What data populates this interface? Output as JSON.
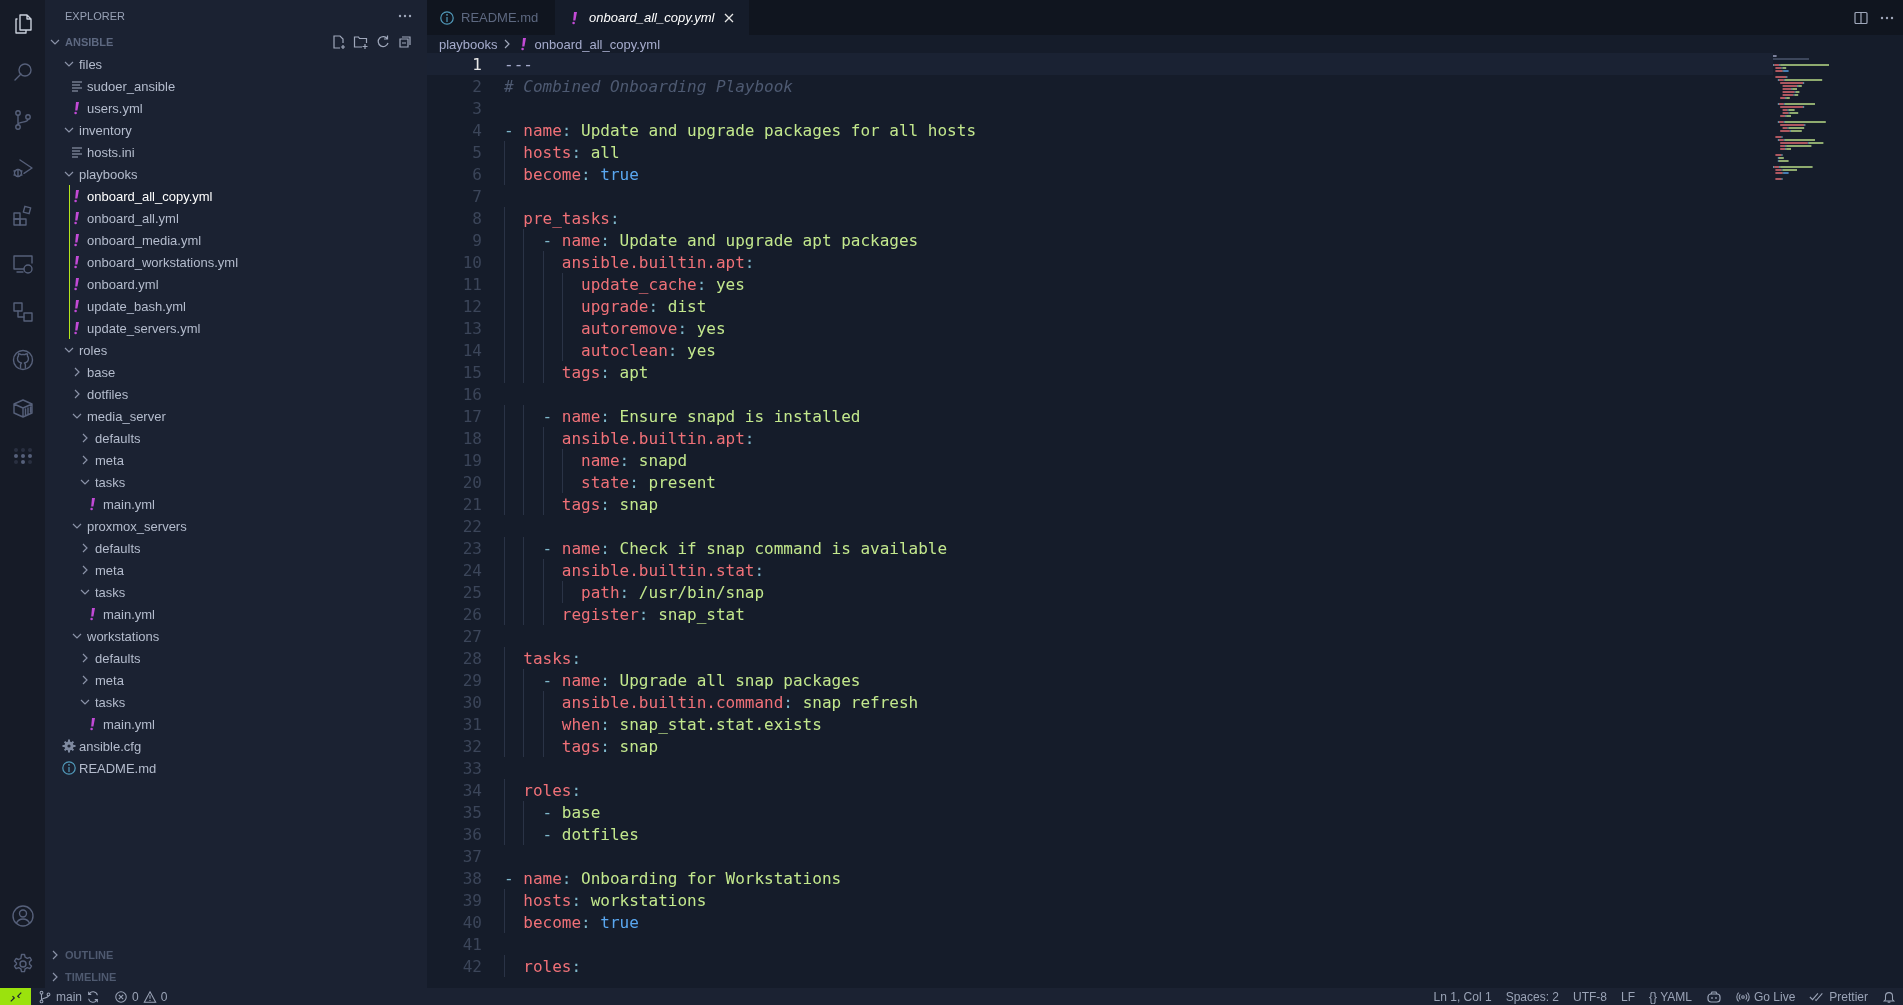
{
  "activity_bar": {
    "items": [
      {
        "kind": "explorer",
        "selected": true
      },
      {
        "kind": "search",
        "selected": false
      },
      {
        "kind": "source_control",
        "selected": false
      },
      {
        "kind": "run_debug",
        "selected": false
      },
      {
        "kind": "extensions",
        "selected": false
      },
      {
        "kind": "remote",
        "selected": false
      },
      {
        "kind": "nodes",
        "selected": false
      },
      {
        "kind": "github",
        "selected": false
      },
      {
        "kind": "container",
        "selected": false
      },
      {
        "kind": "dots",
        "selected": false
      }
    ],
    "bottom": [
      {
        "kind": "account"
      },
      {
        "kind": "settings"
      }
    ]
  },
  "sidebar": {
    "title": "EXPLORER",
    "section": {
      "label": "ANSIBLE",
      "expanded": true,
      "tree": [
        {
          "label": "files",
          "kind": "folder",
          "expanded": true,
          "selected": false,
          "children": [
            {
              "label": "sudoer_ansible",
              "kind": "text",
              "selected": false
            },
            {
              "label": "users.yml",
              "kind": "yaml",
              "selected": false
            }
          ]
        },
        {
          "label": "inventory",
          "kind": "folder",
          "expanded": true,
          "selected": false,
          "children": [
            {
              "label": "hosts.ini",
              "kind": "text",
              "selected": false
            }
          ]
        },
        {
          "label": "playbooks",
          "kind": "folder",
          "expanded": true,
          "selected": false,
          "children": [
            {
              "label": "onboard_all_copy.yml",
              "kind": "yaml",
              "selected": true
            },
            {
              "label": "onboard_all.yml",
              "kind": "yaml",
              "selected": false
            },
            {
              "label": "onboard_media.yml",
              "kind": "yaml",
              "selected": false
            },
            {
              "label": "onboard_workstations.yml",
              "kind": "yaml",
              "selected": false
            },
            {
              "label": "onboard.yml",
              "kind": "yaml",
              "selected": false
            },
            {
              "label": "update_bash.yml",
              "kind": "yaml",
              "selected": false
            },
            {
              "label": "update_servers.yml",
              "kind": "yaml",
              "selected": false
            }
          ]
        },
        {
          "label": "roles",
          "kind": "folder",
          "expanded": true,
          "selected": false,
          "children": [
            {
              "label": "base",
              "kind": "folder",
              "expanded": false,
              "selected": false
            },
            {
              "label": "dotfiles",
              "kind": "folder",
              "expanded": false,
              "selected": false
            },
            {
              "label": "media_server",
              "kind": "folder",
              "expanded": true,
              "selected": false,
              "children": [
                {
                  "label": "defaults",
                  "kind": "folder",
                  "expanded": false,
                  "selected": false
                },
                {
                  "label": "meta",
                  "kind": "folder",
                  "expanded": false,
                  "selected": false
                },
                {
                  "label": "tasks",
                  "kind": "folder",
                  "expanded": true,
                  "selected": false,
                  "children": [
                    {
                      "label": "main.yml",
                      "kind": "yaml",
                      "selected": false
                    }
                  ]
                }
              ]
            },
            {
              "label": "proxmox_servers",
              "kind": "folder",
              "expanded": true,
              "selected": false,
              "children": [
                {
                  "label": "defaults",
                  "kind": "folder",
                  "expanded": false,
                  "selected": false
                },
                {
                  "label": "meta",
                  "kind": "folder",
                  "expanded": false,
                  "selected": false
                },
                {
                  "label": "tasks",
                  "kind": "folder",
                  "expanded": true,
                  "selected": false,
                  "children": [
                    {
                      "label": "main.yml",
                      "kind": "yaml",
                      "selected": false
                    }
                  ]
                }
              ]
            },
            {
              "label": "workstations",
              "kind": "folder",
              "expanded": true,
              "selected": false,
              "children": [
                {
                  "label": "defaults",
                  "kind": "folder",
                  "expanded": false,
                  "selected": false
                },
                {
                  "label": "meta",
                  "kind": "folder",
                  "expanded": false,
                  "selected": false
                },
                {
                  "label": "tasks",
                  "kind": "folder",
                  "expanded": true,
                  "selected": false,
                  "children": [
                    {
                      "label": "main.yml",
                      "kind": "yaml",
                      "selected": false
                    }
                  ]
                }
              ]
            }
          ]
        },
        {
          "label": "ansible.cfg",
          "kind": "config",
          "selected": false
        },
        {
          "label": "README.md",
          "kind": "info",
          "selected": false
        }
      ]
    },
    "panels": [
      {
        "label": "OUTLINE",
        "expanded": false
      },
      {
        "label": "TIMELINE",
        "expanded": false
      }
    ]
  },
  "tabs": [
    {
      "label": "README.md",
      "kind": "info",
      "selected": false,
      "preview": false
    },
    {
      "label": "onboard_all_copy.yml",
      "kind": "yaml",
      "selected": true,
      "preview": true
    }
  ],
  "breadcrumb": [
    {
      "label": "playbooks",
      "kind": "folder"
    },
    {
      "label": "onboard_all_copy.yml",
      "kind": "yaml"
    }
  ],
  "editor": {
    "lines": [
      {
        "number": "1",
        "current": true,
        "tokens": [
          {
            "kind": "plain",
            "text": "---"
          }
        ]
      },
      {
        "number": "2",
        "current": false,
        "tokens": [
          {
            "kind": "comment",
            "text": "# Combined Onboarding Playbook"
          }
        ]
      },
      {
        "number": "3",
        "current": false
      },
      {
        "number": "4",
        "current": false,
        "tokens": [
          {
            "kind": "dash",
            "text": "- "
          },
          {
            "kind": "key",
            "text": "name"
          },
          {
            "kind": "punct",
            "text": ": "
          },
          {
            "kind": "string",
            "text": "Update and upgrade packages for all hosts"
          }
        ]
      },
      {
        "number": "5",
        "current": false,
        "tokens": [
          {
            "kind": "key",
            "text": "  hosts"
          },
          {
            "kind": "punct",
            "text": ": "
          },
          {
            "kind": "string",
            "text": "all"
          }
        ]
      },
      {
        "number": "6",
        "current": false,
        "tokens": [
          {
            "kind": "key",
            "text": "  become"
          },
          {
            "kind": "punct",
            "text": ": "
          },
          {
            "kind": "bool",
            "text": "true"
          }
        ]
      },
      {
        "number": "7",
        "current": false
      },
      {
        "number": "8",
        "current": false,
        "tokens": [
          {
            "kind": "key",
            "text": "  pre_tasks"
          },
          {
            "kind": "punct",
            "text": ":"
          }
        ]
      },
      {
        "number": "9",
        "current": false,
        "tokens": [
          {
            "kind": "dash",
            "text": "    - "
          },
          {
            "kind": "key",
            "text": "name"
          },
          {
            "kind": "punct",
            "text": ": "
          },
          {
            "kind": "string",
            "text": "Update and upgrade apt packages"
          }
        ]
      },
      {
        "number": "10",
        "current": false,
        "tokens": [
          {
            "kind": "key",
            "text": "      ansible.builtin.apt"
          },
          {
            "kind": "punct",
            "text": ":"
          }
        ]
      },
      {
        "number": "11",
        "current": false,
        "tokens": [
          {
            "kind": "key",
            "text": "        update_cache"
          },
          {
            "kind": "punct",
            "text": ": "
          },
          {
            "kind": "string",
            "text": "yes"
          }
        ]
      },
      {
        "number": "12",
        "current": false,
        "tokens": [
          {
            "kind": "key",
            "text": "        upgrade"
          },
          {
            "kind": "punct",
            "text": ": "
          },
          {
            "kind": "string",
            "text": "dist"
          }
        ]
      },
      {
        "number": "13",
        "current": false,
        "tokens": [
          {
            "kind": "key",
            "text": "        autoremove"
          },
          {
            "kind": "punct",
            "text": ": "
          },
          {
            "kind": "string",
            "text": "yes"
          }
        ]
      },
      {
        "number": "14",
        "current": false,
        "tokens": [
          {
            "kind": "key",
            "text": "        autoclean"
          },
          {
            "kind": "punct",
            "text": ": "
          },
          {
            "kind": "string",
            "text": "yes"
          }
        ]
      },
      {
        "number": "15",
        "current": false,
        "tokens": [
          {
            "kind": "key",
            "text": "      tags"
          },
          {
            "kind": "punct",
            "text": ": "
          },
          {
            "kind": "string",
            "text": "apt"
          }
        ]
      },
      {
        "number": "16",
        "current": false
      },
      {
        "number": "17",
        "current": false,
        "tokens": [
          {
            "kind": "dash",
            "text": "    - "
          },
          {
            "kind": "key",
            "text": "name"
          },
          {
            "kind": "punct",
            "text": ": "
          },
          {
            "kind": "string",
            "text": "Ensure snapd is installed"
          }
        ]
      },
      {
        "number": "18",
        "current": false,
        "tokens": [
          {
            "kind": "key",
            "text": "      ansible.builtin.apt"
          },
          {
            "kind": "punct",
            "text": ":"
          }
        ]
      },
      {
        "number": "19",
        "current": false,
        "tokens": [
          {
            "kind": "key",
            "text": "        name"
          },
          {
            "kind": "punct",
            "text": ": "
          },
          {
            "kind": "string",
            "text": "snapd"
          }
        ]
      },
      {
        "number": "20",
        "current": false,
        "tokens": [
          {
            "kind": "key",
            "text": "        state"
          },
          {
            "kind": "punct",
            "text": ": "
          },
          {
            "kind": "string",
            "text": "present"
          }
        ]
      },
      {
        "number": "21",
        "current": false,
        "tokens": [
          {
            "kind": "key",
            "text": "      tags"
          },
          {
            "kind": "punct",
            "text": ": "
          },
          {
            "kind": "string",
            "text": "snap"
          }
        ]
      },
      {
        "number": "22",
        "current": false
      },
      {
        "number": "23",
        "current": false,
        "tokens": [
          {
            "kind": "dash",
            "text": "    - "
          },
          {
            "kind": "key",
            "text": "name"
          },
          {
            "kind": "punct",
            "text": ": "
          },
          {
            "kind": "string",
            "text": "Check if snap command is available"
          }
        ]
      },
      {
        "number": "24",
        "current": false,
        "tokens": [
          {
            "kind": "key",
            "text": "      ansible.builtin.stat"
          },
          {
            "kind": "punct",
            "text": ":"
          }
        ]
      },
      {
        "number": "25",
        "current": false,
        "tokens": [
          {
            "kind": "key",
            "text": "        path"
          },
          {
            "kind": "punct",
            "text": ": "
          },
          {
            "kind": "string",
            "text": "/usr/bin/snap"
          }
        ]
      },
      {
        "number": "26",
        "current": false,
        "tokens": [
          {
            "kind": "key",
            "text": "      register"
          },
          {
            "kind": "punct",
            "text": ": "
          },
          {
            "kind": "string",
            "text": "snap_stat"
          }
        ]
      },
      {
        "number": "27",
        "current": false
      },
      {
        "number": "28",
        "current": false,
        "tokens": [
          {
            "kind": "key",
            "text": "  tasks"
          },
          {
            "kind": "punct",
            "text": ":"
          }
        ]
      },
      {
        "number": "29",
        "current": false,
        "tokens": [
          {
            "kind": "dash",
            "text": "    - "
          },
          {
            "kind": "key",
            "text": "name"
          },
          {
            "kind": "punct",
            "text": ": "
          },
          {
            "kind": "string",
            "text": "Upgrade all snap packages"
          }
        ]
      },
      {
        "number": "30",
        "current": false,
        "tokens": [
          {
            "kind": "key",
            "text": "      ansible.builtin.command"
          },
          {
            "kind": "punct",
            "text": ": "
          },
          {
            "kind": "string",
            "text": "snap refresh"
          }
        ]
      },
      {
        "number": "31",
        "current": false,
        "tokens": [
          {
            "kind": "key",
            "text": "      when"
          },
          {
            "kind": "punct",
            "text": ": "
          },
          {
            "kind": "string",
            "text": "snap_stat.stat.exists"
          }
        ]
      },
      {
        "number": "32",
        "current": false,
        "tokens": [
          {
            "kind": "key",
            "text": "      tags"
          },
          {
            "kind": "punct",
            "text": ": "
          },
          {
            "kind": "string",
            "text": "snap"
          }
        ]
      },
      {
        "number": "33",
        "current": false
      },
      {
        "number": "34",
        "current": false,
        "tokens": [
          {
            "kind": "key",
            "text": "  roles"
          },
          {
            "kind": "punct",
            "text": ":"
          }
        ]
      },
      {
        "number": "35",
        "current": false,
        "tokens": [
          {
            "kind": "dash",
            "text": "    - "
          },
          {
            "kind": "string",
            "text": "base"
          }
        ]
      },
      {
        "number": "36",
        "current": false,
        "tokens": [
          {
            "kind": "dash",
            "text": "    - "
          },
          {
            "kind": "string",
            "text": "dotfiles"
          }
        ]
      },
      {
        "number": "37",
        "current": false
      },
      {
        "number": "38",
        "current": false,
        "tokens": [
          {
            "kind": "dash",
            "text": "- "
          },
          {
            "kind": "key",
            "text": "name"
          },
          {
            "kind": "punct",
            "text": ": "
          },
          {
            "kind": "string",
            "text": "Onboarding for Workstations"
          }
        ]
      },
      {
        "number": "39",
        "current": false,
        "tokens": [
          {
            "kind": "key",
            "text": "  hosts"
          },
          {
            "kind": "punct",
            "text": ": "
          },
          {
            "kind": "string",
            "text": "workstations"
          }
        ]
      },
      {
        "number": "40",
        "current": false,
        "tokens": [
          {
            "kind": "key",
            "text": "  become"
          },
          {
            "kind": "punct",
            "text": ": "
          },
          {
            "kind": "bool",
            "text": "true"
          }
        ]
      },
      {
        "number": "41",
        "current": false
      },
      {
        "number": "42",
        "current": false,
        "tokens": [
          {
            "kind": "key",
            "text": "  roles"
          },
          {
            "kind": "punct",
            "text": ":"
          }
        ]
      }
    ]
  },
  "status_bar": {
    "branch": "main",
    "errors": "0",
    "warnings": "0",
    "items": [
      {
        "kind": "text",
        "label": "Ln 1, Col 1"
      },
      {
        "kind": "text",
        "label": "Spaces: 2"
      },
      {
        "kind": "text",
        "label": "UTF-8"
      },
      {
        "kind": "text",
        "label": "LF"
      },
      {
        "kind": "text",
        "label": "{} YAML"
      },
      {
        "kind": "copilot"
      },
      {
        "kind": "live",
        "label": "Go Live"
      },
      {
        "kind": "prettier",
        "label": "Prettier"
      },
      {
        "kind": "bell"
      }
    ]
  }
}
